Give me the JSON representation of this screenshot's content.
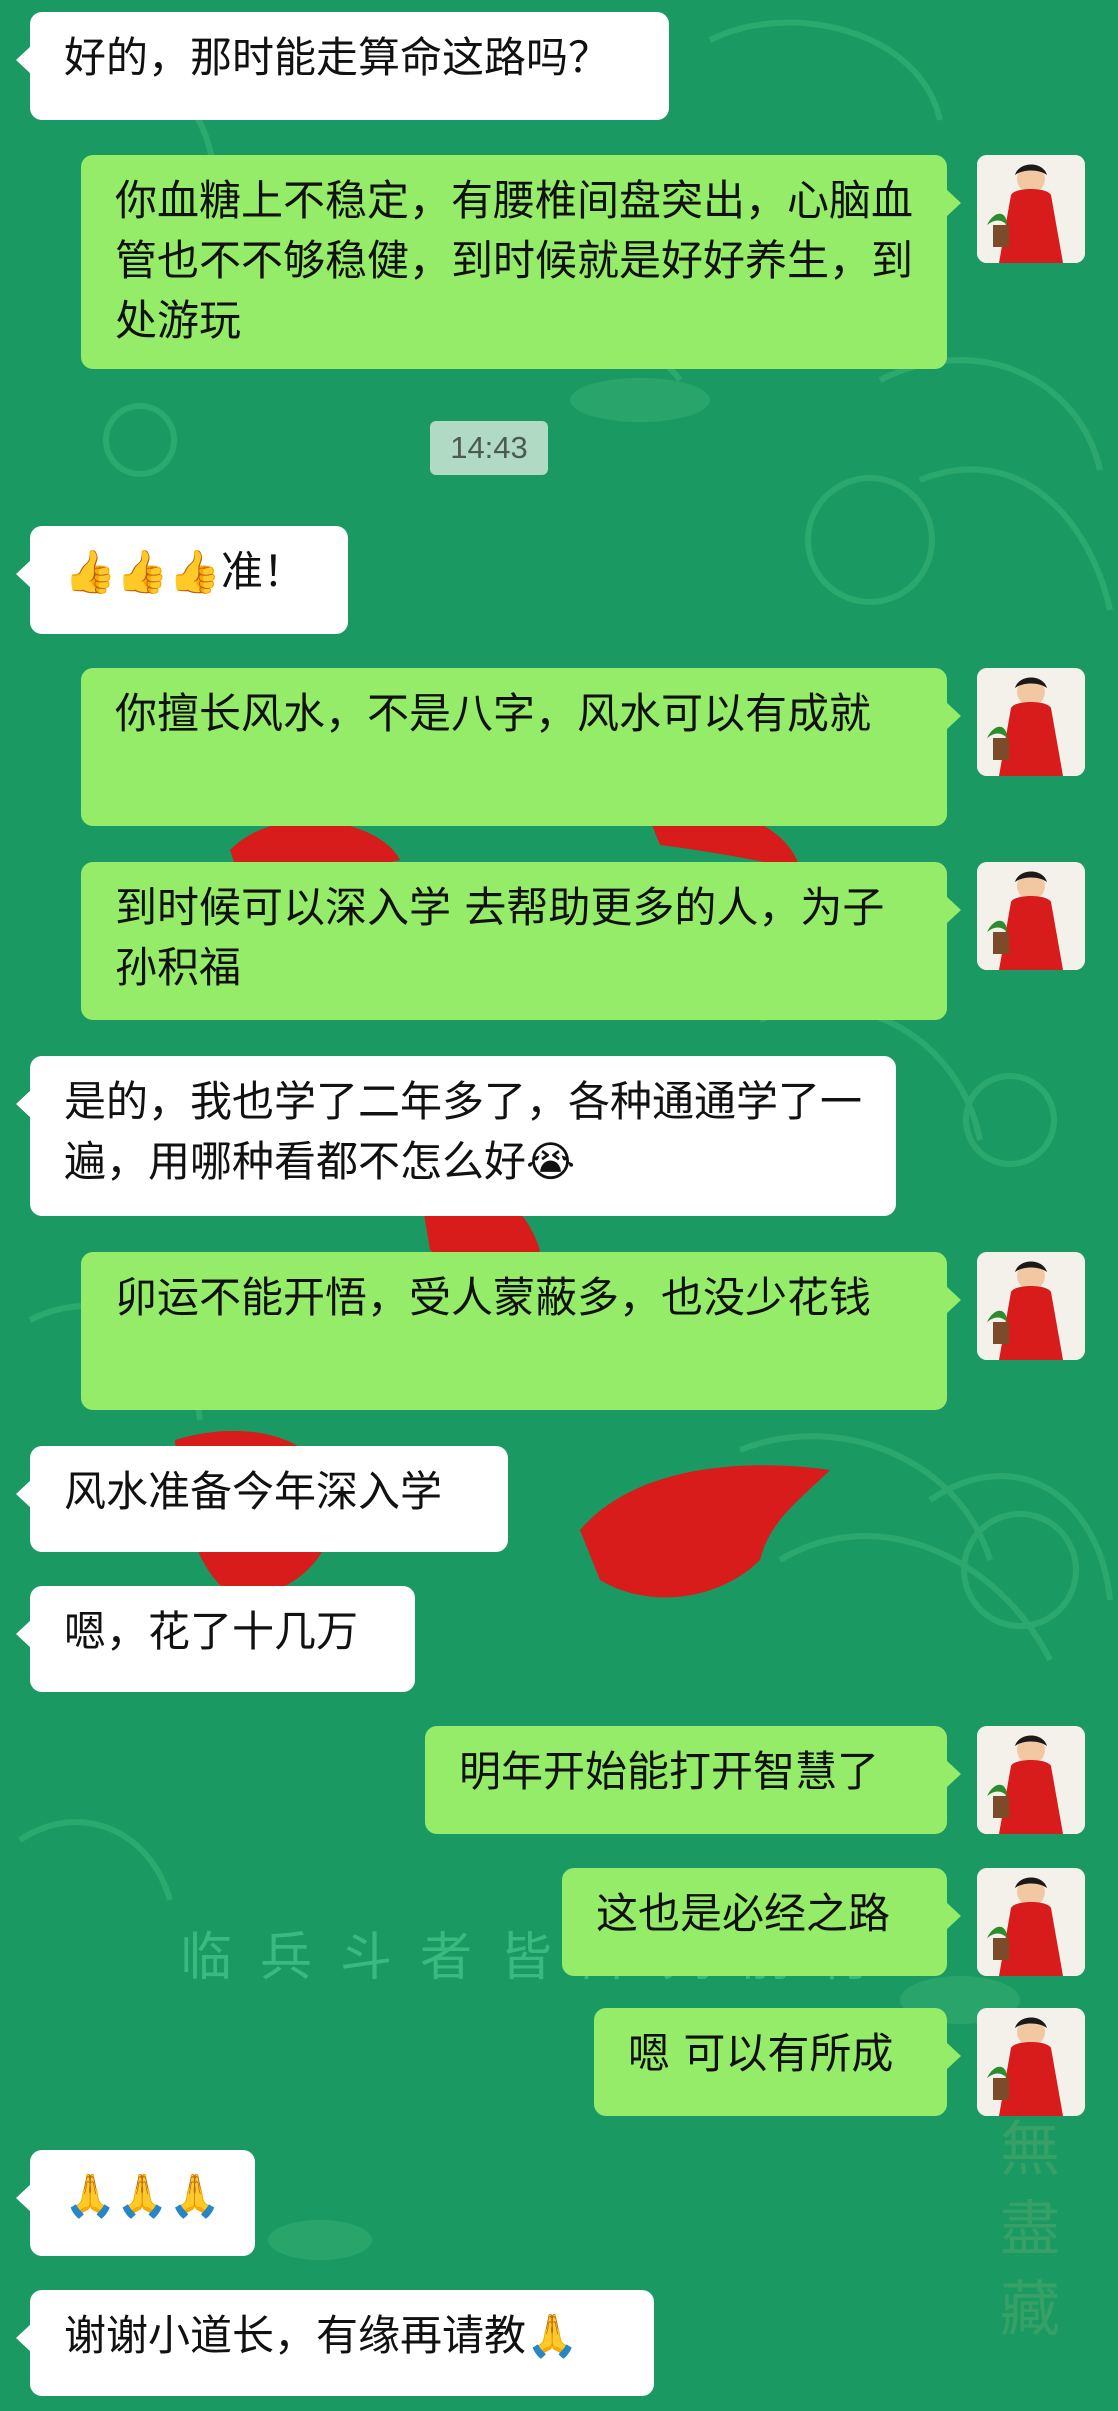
{
  "conversation": {
    "messages": [
      {
        "side": "in",
        "text": "好的，那时能走算命这路吗？"
      },
      {
        "side": "out",
        "text": "你血糖上不稳定，有腰椎间盘突出，心脑血管也不不够稳健，到时候就是好好养生，到处游玩"
      },
      {
        "side": "in",
        "text": "👍👍👍准！"
      },
      {
        "side": "out",
        "text": "你擅长风水，不是八字，风水可以有成就"
      },
      {
        "side": "out",
        "text": "到时候可以深入学 去帮助更多的人，为子孙积福"
      },
      {
        "side": "in",
        "text": "是的，我也学了二年多了，各种通通学了一遍，用哪种看都不怎么好😭"
      },
      {
        "side": "out",
        "text": "卯运不能开悟，受人蒙蔽多，也没少花钱"
      },
      {
        "side": "in",
        "text": "风水准备今年深入学"
      },
      {
        "side": "in",
        "text": "嗯，花了十几万"
      },
      {
        "side": "out",
        "text": "明年开始能打开智慧了"
      },
      {
        "side": "out",
        "text": "这也是必经之路"
      },
      {
        "side": "out",
        "text": "嗯 可以有所成"
      },
      {
        "side": "in",
        "text": "🙏🙏🙏"
      },
      {
        "side": "in",
        "text": "谢谢小道长，有缘再请教🙏"
      }
    ],
    "timestamp": "14:43"
  },
  "background": {
    "watermark_text": "临兵斗者皆阵列前行",
    "corner_text": "無盡藏",
    "primary_color": "#1a9a62",
    "pattern_color": "#3bb57a",
    "seal_color": "#d81b1b"
  },
  "avatar": {
    "icon": "avatar-icon",
    "robe_color": "#d81b1b",
    "plant_color": "#2e8b2e"
  }
}
